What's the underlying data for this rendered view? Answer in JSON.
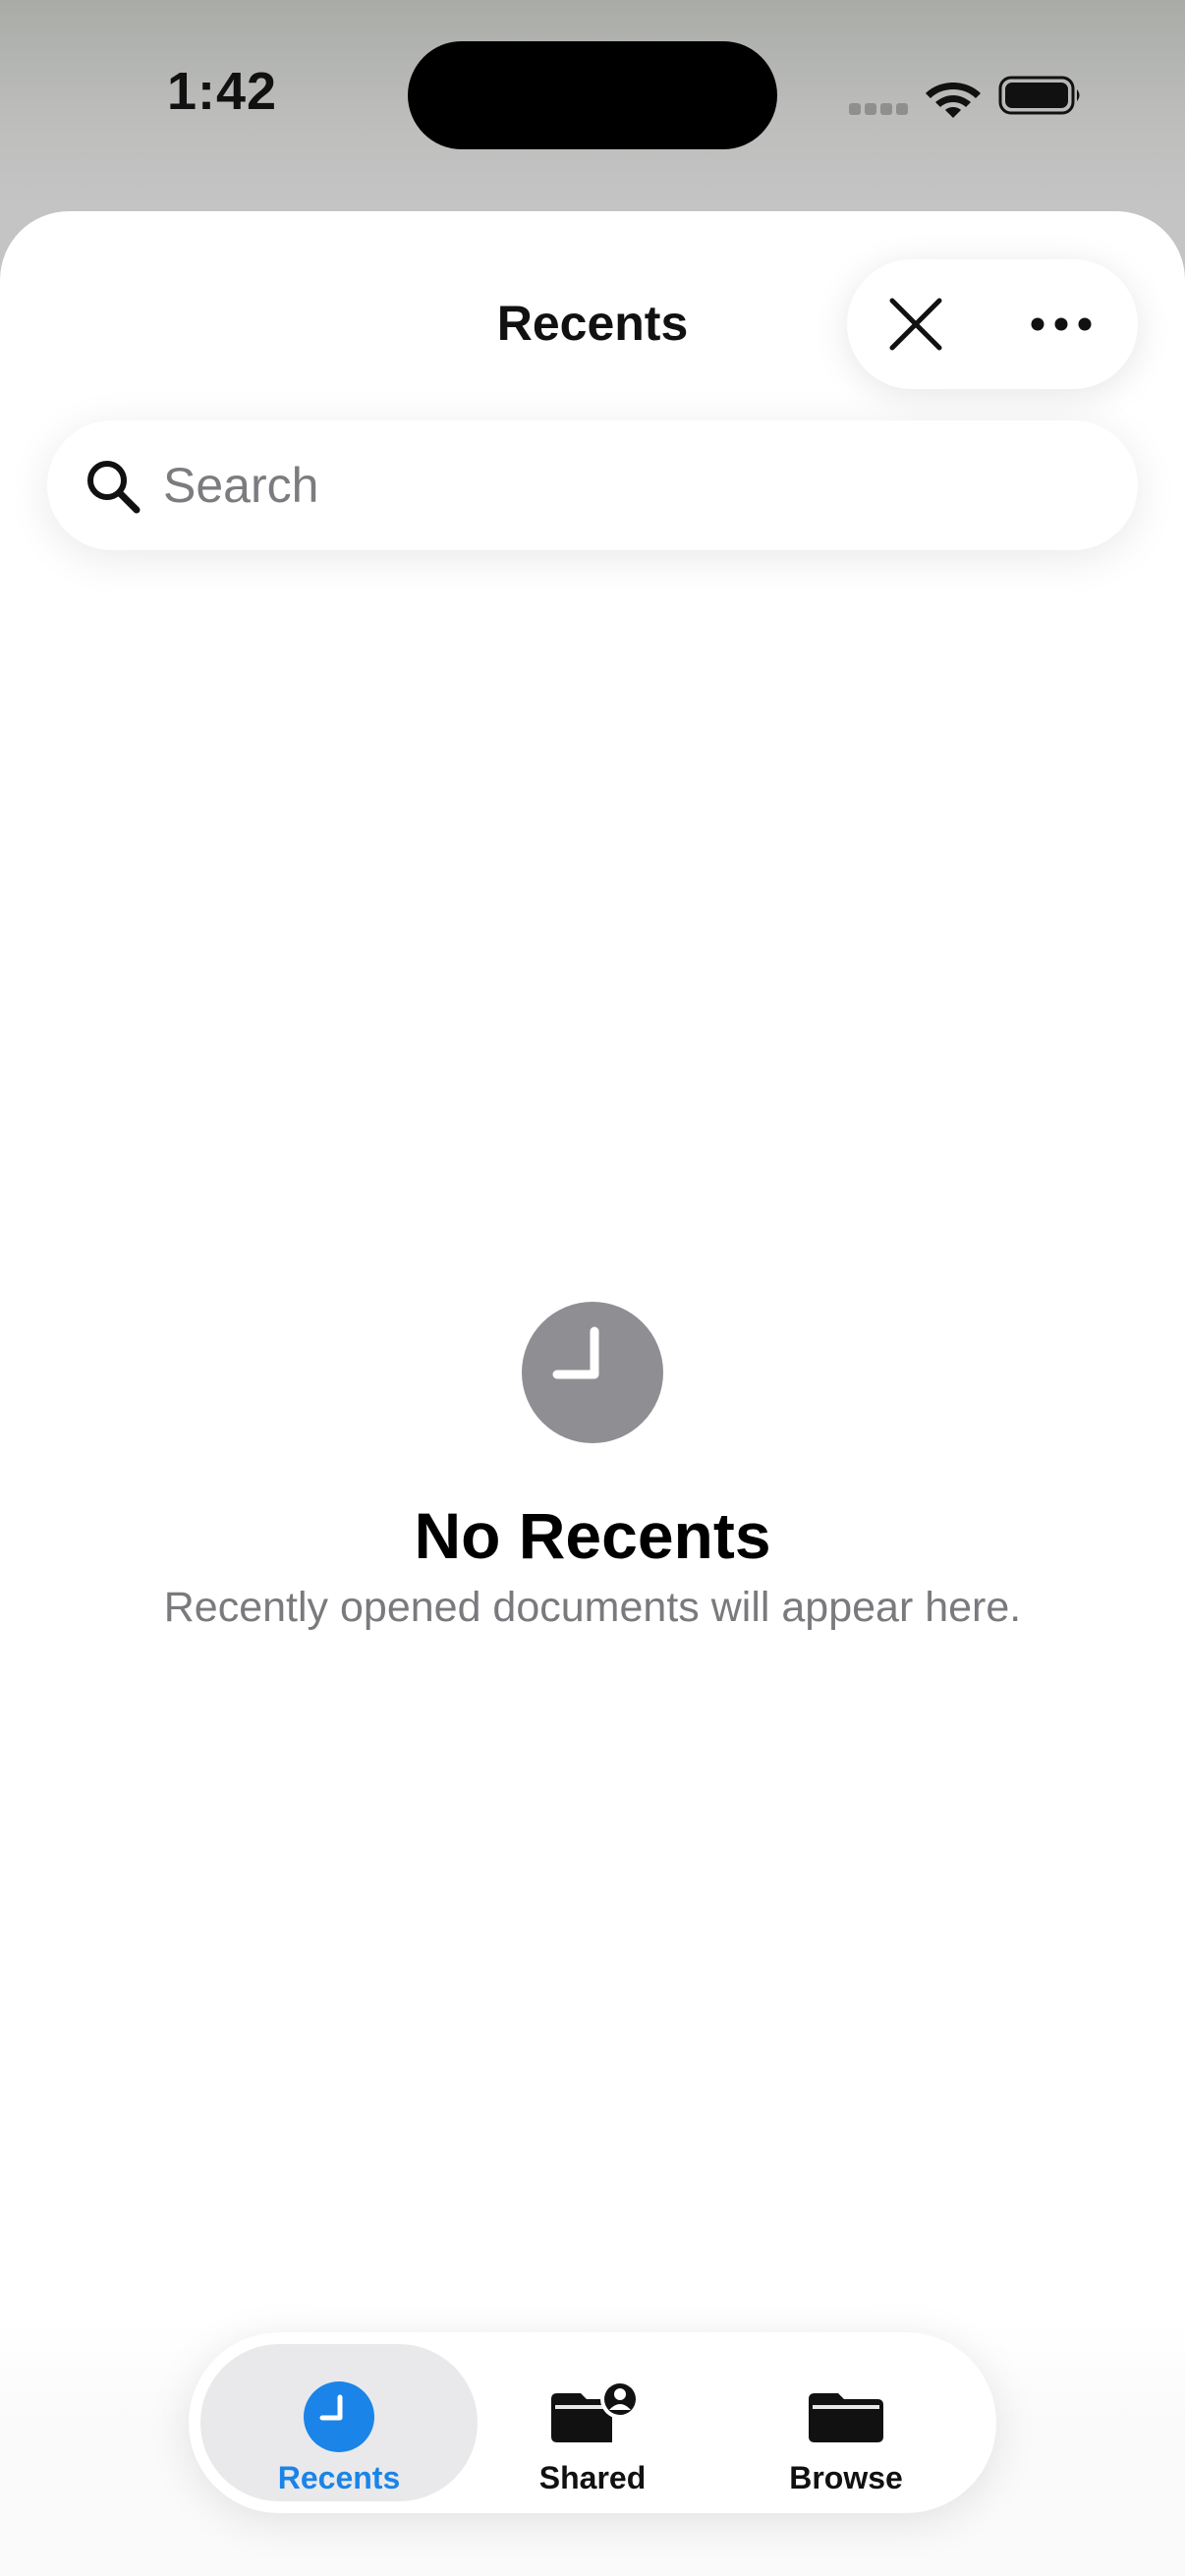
{
  "status_bar": {
    "time": "1:42"
  },
  "header": {
    "title": "Recents",
    "close_icon": "close-icon",
    "more_icon": "ellipsis-icon"
  },
  "search": {
    "placeholder": "Search",
    "value": "",
    "icon": "search-icon"
  },
  "empty_state": {
    "icon": "clock-icon",
    "title": "No Recents",
    "subtitle": "Recently opened documents will appear here."
  },
  "tab_bar": {
    "active": "Recents",
    "items": [
      {
        "label": "Recents",
        "icon": "clock-icon"
      },
      {
        "label": "Shared",
        "icon": "shared-folder-icon"
      },
      {
        "label": "Browse",
        "icon": "folder-icon"
      }
    ]
  },
  "colors": {
    "accent": "#1a84e8",
    "empty_icon": "#8e8e93",
    "subtitle": "#7a7a7e",
    "tab_active_bg": "#e9e9eb"
  }
}
